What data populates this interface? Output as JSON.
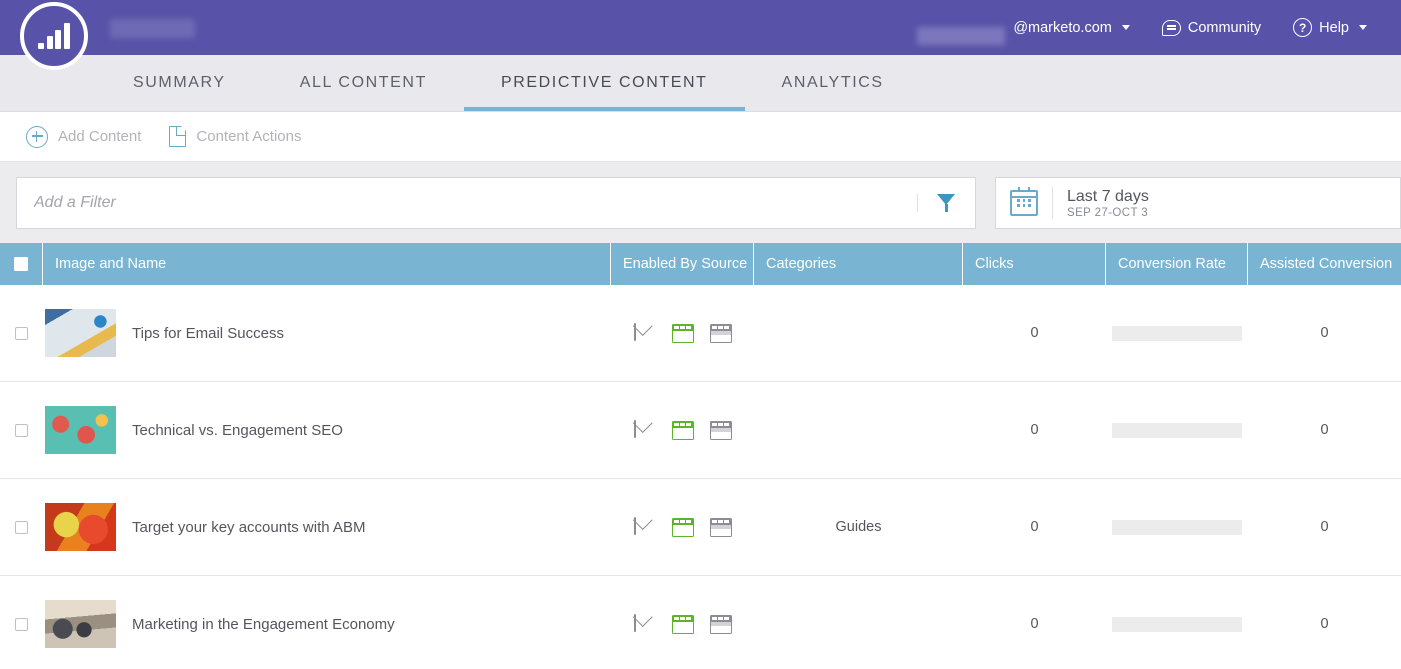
{
  "header": {
    "logo_name": "marketo-logo",
    "account_suffix": "@marketo.com",
    "community_label": "Community",
    "help_label": "Help"
  },
  "nav": {
    "tabs": [
      {
        "label": "SUMMARY",
        "active": false
      },
      {
        "label": "ALL CONTENT",
        "active": false
      },
      {
        "label": "PREDICTIVE CONTENT",
        "active": true
      },
      {
        "label": "ANALYTICS",
        "active": false
      }
    ]
  },
  "toolbar": {
    "add_content_label": "Add Content",
    "content_actions_label": "Content Actions"
  },
  "filter": {
    "placeholder": "Add a Filter",
    "value": "",
    "funnel_icon": "filter-icon"
  },
  "daterange": {
    "label": "Last 7 days",
    "sub": "SEP 27-OCT 3",
    "icon": "calendar-icon"
  },
  "table": {
    "columns": [
      "Image and Name",
      "Enabled By Source",
      "Categories",
      "Clicks",
      "Conversion Rate",
      "Assisted Conversion"
    ],
    "rows": [
      {
        "name": "Tips for Email Success",
        "thumb_class": "th1",
        "sources": [
          {
            "icon": "email-icon",
            "state": "inactive"
          },
          {
            "icon": "web-page-icon",
            "state": "active"
          },
          {
            "icon": "dialog-icon",
            "state": "inactive"
          }
        ],
        "categories": "",
        "clicks": "0",
        "conversion_rate": "",
        "assisted_conversion": "0"
      },
      {
        "name": "Technical vs. Engagement SEO",
        "thumb_class": "th2",
        "sources": [
          {
            "icon": "email-icon",
            "state": "inactive"
          },
          {
            "icon": "web-page-icon",
            "state": "active"
          },
          {
            "icon": "dialog-icon",
            "state": "inactive"
          }
        ],
        "categories": "",
        "clicks": "0",
        "conversion_rate": "",
        "assisted_conversion": "0"
      },
      {
        "name": "Target your key accounts with ABM",
        "thumb_class": "th3",
        "sources": [
          {
            "icon": "email-icon",
            "state": "inactive"
          },
          {
            "icon": "web-page-icon",
            "state": "active"
          },
          {
            "icon": "dialog-icon",
            "state": "inactive"
          }
        ],
        "categories": "Guides",
        "clicks": "0",
        "conversion_rate": "",
        "assisted_conversion": "0"
      },
      {
        "name": "Marketing in the Engagement Economy",
        "thumb_class": "th4",
        "sources": [
          {
            "icon": "email-icon",
            "state": "inactive"
          },
          {
            "icon": "web-page-icon",
            "state": "active"
          },
          {
            "icon": "dialog-icon",
            "state": "inactive"
          }
        ],
        "categories": "",
        "clicks": "0",
        "conversion_rate": "",
        "assisted_conversion": "0"
      }
    ]
  },
  "colors": {
    "brand_purple": "#5853a8",
    "table_header_blue": "#79b5d2",
    "accent_teal": "#6aa9c9",
    "active_green": "#5cb427",
    "nav_bg": "#e9e9ed"
  }
}
